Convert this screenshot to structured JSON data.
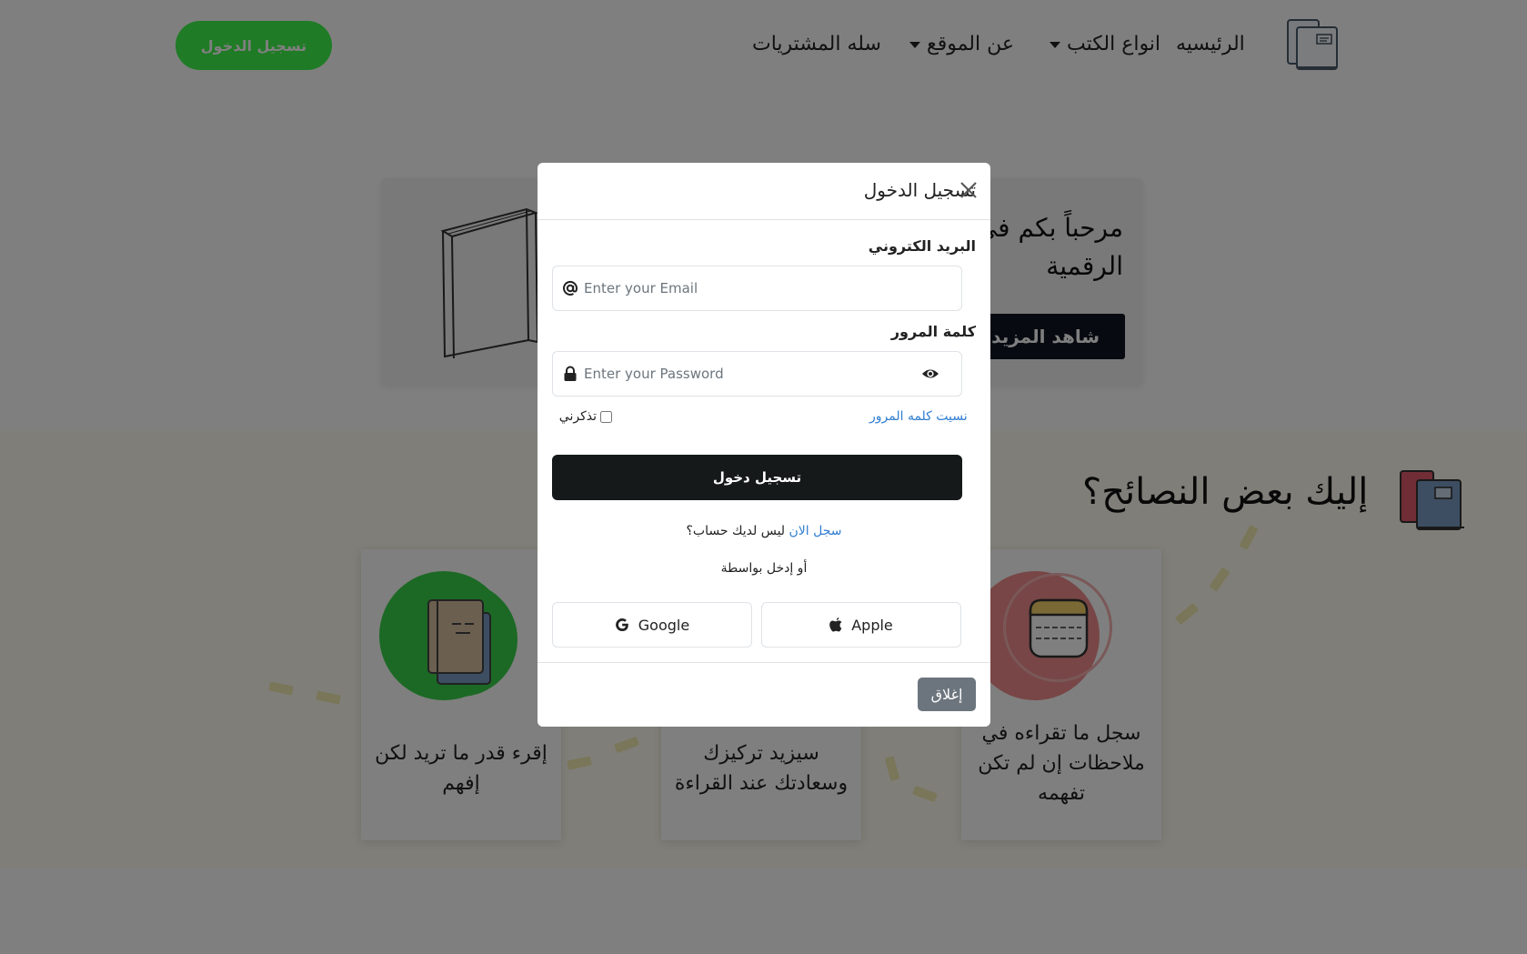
{
  "nav": {
    "items": [
      {
        "label": "الرئيسيه"
      },
      {
        "label": "انواع الكتب"
      },
      {
        "label": "عن الموقع"
      },
      {
        "label": "سله المشتريات"
      }
    ],
    "login_button": "تسجيل الدخول",
    "accent_color": "#3ff74a"
  },
  "hero": {
    "title": "مرحباً بكم في الرقمية",
    "button": "شاهد المزيد"
  },
  "tips": {
    "title": "إليك بعض النصائح؟",
    "cards": [
      {
        "text": "إقرء قدر ما تريد لكن إفهم",
        "icon": "notebook-icon"
      },
      {
        "text": "سيزيد تركيزك وسعادتك عند القراءة",
        "icon": "book-icon"
      },
      {
        "text": "سجل ما تقراءه في ملاحظات إن لم تكن تفهمه",
        "icon": "notes-icon"
      }
    ]
  },
  "modal": {
    "title": "تسجيل الدخول",
    "email_label": "البريد الكتروني",
    "email_placeholder": "Enter your Email",
    "password_label": "كلمة المرور",
    "password_placeholder": "Enter your Password",
    "remember_label": "تذكرني",
    "forgot_link": "نسيت كلمه المرور",
    "submit_button": "تسجيل دخول",
    "no_account_text": "ليس لديك حساب؟",
    "register_link": "سجل الان",
    "or_text": "أو إدخل بواسطة",
    "apple_button": "Apple",
    "google_button": "Google",
    "close_button": "إغلاق"
  }
}
